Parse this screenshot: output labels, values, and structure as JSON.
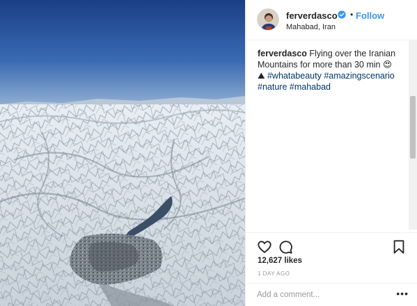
{
  "post": {
    "photo_alt": "Aerial view of snow-covered mountains",
    "username": "ferverdasco",
    "follow_label": "Follow",
    "dot": "•",
    "location": "Mahabad, Iran",
    "caption": {
      "user": "ferverdasco",
      "text": " Flying over the Iranian Mountains for more than 30 min 😍 ⛰ ",
      "tags": [
        "#whatabeauty",
        "#amazingscenario",
        "#nature",
        "#mahabad"
      ]
    },
    "likes": "12,627 likes",
    "time": "1 DAY AGO",
    "comment_placeholder": "Add a comment...",
    "more_label": "•••"
  },
  "colors": {
    "link": "#3897f0",
    "hashtag": "#003569",
    "verified": "#3897f0"
  },
  "icons": {
    "like": "heart-icon",
    "comment": "comment-icon",
    "save": "bookmark-icon",
    "verified": "verified-badge-icon"
  }
}
